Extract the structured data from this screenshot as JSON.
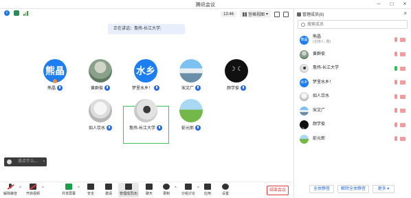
{
  "window": {
    "title": "腾讯会议"
  },
  "meeting": {
    "time": "13:46",
    "view_label": "宫格视图",
    "speaking_banner": "正在讲话：詹炜-长江大学;",
    "participants": [
      {
        "name": "熊晶",
        "avatar_text": "熊晶"
      },
      {
        "name": "黄群俊"
      },
      {
        "name": "梦里水乡！",
        "avatar_text": "水乡"
      },
      {
        "name": "宋文广"
      },
      {
        "name": "颜学俊"
      },
      {
        "name": "如人饮水"
      },
      {
        "name": "詹炜-长江大学"
      },
      {
        "name": "彭元郎"
      }
    ],
    "chat_placeholder": "说点什么..."
  },
  "toolbar": {
    "mute_label": "解除静音",
    "video_label": "开启视频",
    "share_label": "共享屏幕",
    "security_label": "安全",
    "invite_label": "邀请",
    "manage_label": "管理成员(8)",
    "chat_label": "聊天",
    "record_label": "录制",
    "breakout_label": "分组讨论",
    "apps_label": "应用",
    "settings_label": "设置",
    "end_label": "结束会议"
  },
  "panel": {
    "title": "管理成员(8)",
    "search_placeholder": "搜索成员",
    "members": [
      {
        "name": "熊晶",
        "sub": "(主持人, 我)",
        "avatar_text": "熊晶"
      },
      {
        "name": "黄群俊"
      },
      {
        "name": "詹炜-长江大学"
      },
      {
        "name": "梦里水乡！",
        "avatar_text": "水乡"
      },
      {
        "name": "如人饮水"
      },
      {
        "name": "宋文广"
      },
      {
        "name": "颜学俊"
      },
      {
        "name": "彭元郎"
      }
    ],
    "mute_all_label": "全体静音",
    "unmute_all_label": "解除全体静音",
    "more_label": "更多"
  },
  "colors": {
    "accent": "#2a6ae0",
    "end_red": "#e23b3b",
    "active_green": "#3cc35a"
  }
}
